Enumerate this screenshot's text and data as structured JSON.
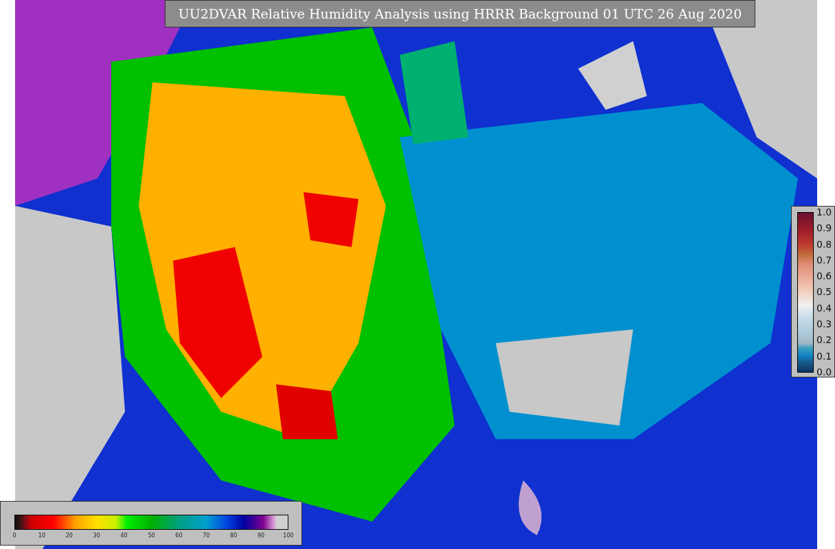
{
  "title": "UU2DVAR Relative Humidity Analysis using HRRR Background 01 UTC 26 Aug 2020",
  "right_colorbar": {
    "ticks": [
      "1.0",
      "0.9",
      "0.8",
      "0.7",
      "0.6",
      "0.5",
      "0.4",
      "0.3",
      "0.2",
      "0.1",
      "0.0"
    ]
  },
  "bottom_colorbar": {
    "ticks": [
      "0",
      "10",
      "20",
      "30",
      "40",
      "50",
      "60",
      "70",
      "80",
      "90",
      "100"
    ]
  }
}
